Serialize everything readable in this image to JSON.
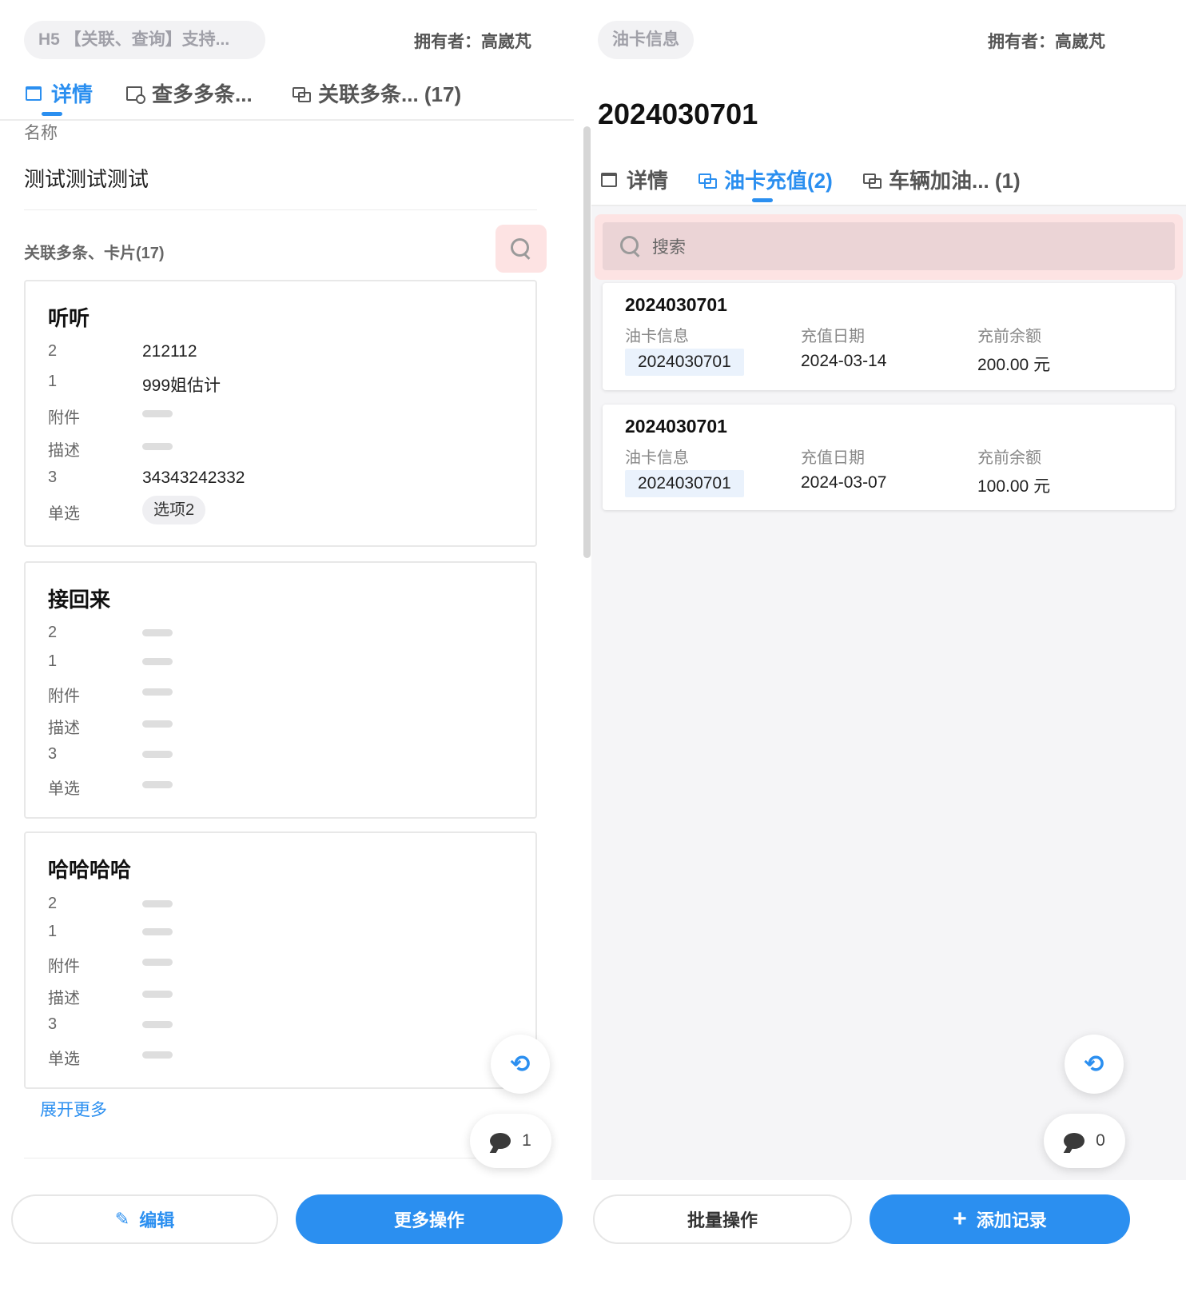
{
  "left": {
    "title_pill": "H5 【关联、查询】支持...",
    "owner": "拥有者：高崴芃",
    "tabs": [
      {
        "label": "详情",
        "icon": "folder-icon",
        "active": true
      },
      {
        "label": "查多多条...",
        "icon": "search-doc-icon",
        "active": false
      },
      {
        "label": "关联多条... (17)",
        "icon": "link-icon",
        "active": false
      }
    ],
    "name_label": "名称",
    "name_value": "测试测试测试",
    "section_title": "关联多条、卡片(17)",
    "cards": [
      {
        "title": "听听",
        "rows": [
          {
            "label": "2",
            "value": "212112"
          },
          {
            "label": "1",
            "value": "999姐估计"
          },
          {
            "label": "附件",
            "value": ""
          },
          {
            "label": "描述",
            "value": ""
          },
          {
            "label": "3",
            "value": "34343242332"
          },
          {
            "label": "单选",
            "value": "选项2"
          }
        ]
      },
      {
        "title": "接回来",
        "rows": [
          {
            "label": "2",
            "value": ""
          },
          {
            "label": "1",
            "value": ""
          },
          {
            "label": "附件",
            "value": ""
          },
          {
            "label": "描述",
            "value": ""
          },
          {
            "label": "3",
            "value": ""
          },
          {
            "label": "单选",
            "value": ""
          }
        ]
      },
      {
        "title": "哈哈哈哈",
        "rows": [
          {
            "label": "2",
            "value": ""
          },
          {
            "label": "1",
            "value": ""
          },
          {
            "label": "附件",
            "value": ""
          },
          {
            "label": "描述",
            "value": ""
          },
          {
            "label": "3",
            "value": ""
          },
          {
            "label": "单选",
            "value": ""
          }
        ]
      }
    ],
    "expand_more": "展开更多",
    "comment_count": "1",
    "buttons": {
      "edit": "编辑",
      "more": "更多操作"
    }
  },
  "right": {
    "title_pill": "油卡信息",
    "owner": "拥有者：高崴芃",
    "record_title": "2024030701",
    "tabs": [
      {
        "label": "详情",
        "icon": "folder-icon",
        "active": false
      },
      {
        "label": "油卡充值(2)",
        "icon": "link-icon",
        "active": true
      },
      {
        "label": "车辆加油... (1)",
        "icon": "link-icon",
        "active": false
      }
    ],
    "search_placeholder": "搜索",
    "records": [
      {
        "title": "2024030701",
        "col1_label": "油卡信息",
        "col1_value": "2024030701",
        "col2_label": "充值日期",
        "col2_value": "2024-03-14",
        "col3_label": "充前余额",
        "col3_value": "200.00 元"
      },
      {
        "title": "2024030701",
        "col1_label": "油卡信息",
        "col1_value": "2024030701",
        "col2_label": "充值日期",
        "col2_value": "2024-03-07",
        "col3_label": "充前余额",
        "col3_value": "100.00 元"
      }
    ],
    "comment_count": "0",
    "buttons": {
      "batch": "批量操作",
      "add": "添加记录"
    }
  },
  "colors": {
    "accent": "#2b8ff0",
    "highlight": "#fde3e3"
  }
}
